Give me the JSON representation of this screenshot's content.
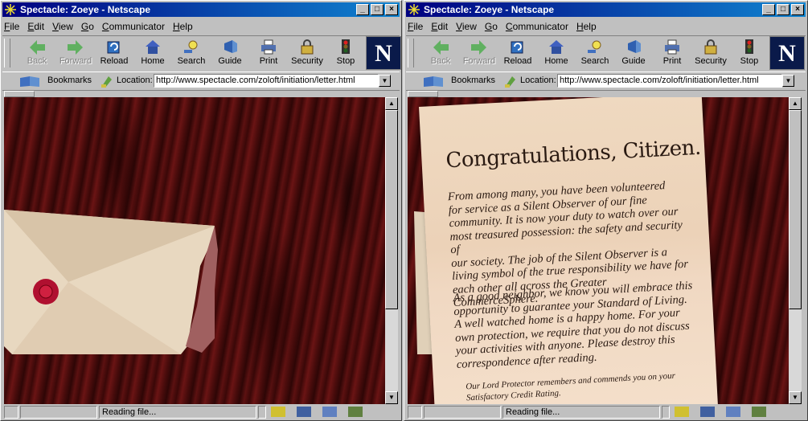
{
  "windows": [
    {
      "title": "Spectacle: Zoeye - Netscape",
      "menu": [
        "File",
        "Edit",
        "View",
        "Go",
        "Communicator",
        "Help"
      ],
      "toolbar": [
        {
          "label": "Back",
          "icon": "back-arrow-icon",
          "enabled": false
        },
        {
          "label": "Forward",
          "icon": "forward-arrow-icon",
          "enabled": false
        },
        {
          "label": "Reload",
          "icon": "reload-icon",
          "enabled": true
        },
        {
          "label": "Home",
          "icon": "home-icon",
          "enabled": true
        },
        {
          "label": "Search",
          "icon": "search-icon",
          "enabled": true
        },
        {
          "label": "Guide",
          "icon": "guide-icon",
          "enabled": true
        },
        {
          "label": "Print",
          "icon": "print-icon",
          "enabled": true
        },
        {
          "label": "Security",
          "icon": "security-icon",
          "enabled": true
        },
        {
          "label": "Stop",
          "icon": "stop-icon",
          "enabled": true
        }
      ],
      "bookmarks_label": "Bookmarks",
      "location_label": "Location:",
      "url": "http://www.spectacle.com/zoloft/initiation/letter.html",
      "status": "Reading file...",
      "scroll_fraction": 0.0
    },
    {
      "title": "Spectacle: Zoeye - Netscape",
      "menu": [
        "File",
        "Edit",
        "View",
        "Go",
        "Communicator",
        "Help"
      ],
      "toolbar": [
        {
          "label": "Back",
          "icon": "back-arrow-icon",
          "enabled": false
        },
        {
          "label": "Forward",
          "icon": "forward-arrow-icon",
          "enabled": false
        },
        {
          "label": "Reload",
          "icon": "reload-icon",
          "enabled": true
        },
        {
          "label": "Home",
          "icon": "home-icon",
          "enabled": true
        },
        {
          "label": "Search",
          "icon": "search-icon",
          "enabled": true
        },
        {
          "label": "Guide",
          "icon": "guide-icon",
          "enabled": true
        },
        {
          "label": "Print",
          "icon": "print-icon",
          "enabled": true
        },
        {
          "label": "Security",
          "icon": "security-icon",
          "enabled": true
        },
        {
          "label": "Stop",
          "icon": "stop-icon",
          "enabled": true
        }
      ],
      "bookmarks_label": "Bookmarks",
      "location_label": "Location:",
      "url": "http://www.spectacle.com/zoloft/initiation/letter.html",
      "status": "Reading file...",
      "scroll_fraction": 0.0
    }
  ],
  "letter": {
    "heading": "Congratulations, Citizen.",
    "paragraph1": [
      "From among many,  you have been volunteered",
      "for service as a Silent Observer of our fine",
      "community. It is now your duty to watch over our",
      "most treasured possession: the safety and security of",
      "our society. The job of the Silent Observer is a",
      "living symbol of the true responsibility we have for",
      "each other all across the Greater CommerceSphere."
    ],
    "paragraph2": [
      "As a good neighbor, we know you will embrace this",
      "opportunity to guarantee your Standard of Living.",
      "A well watched home is a happy home. For your",
      "own protection, we require that you do not discuss",
      "your activities with anyone. Please destroy this",
      "correspondence after reading."
    ],
    "footer": [
      "Our Lord Protector remembers and commends you on your",
      "Satisfactory Credit Rating."
    ]
  },
  "colors": {
    "titlebar": "#000080",
    "wax_seal": "#b01030",
    "envelope": "#e8d8c0"
  }
}
